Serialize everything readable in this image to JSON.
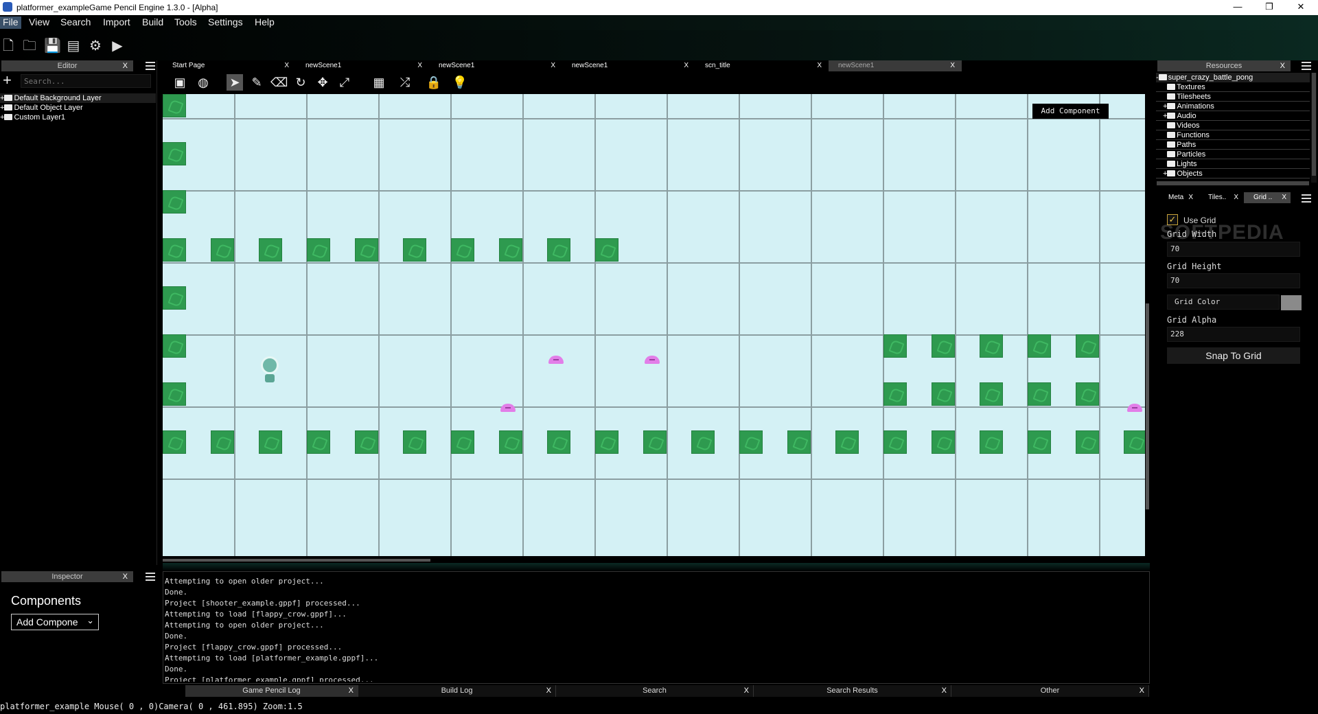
{
  "titlebar": {
    "title": "platformer_exampleGame Pencil Engine  1.3.0 - [Alpha]",
    "minimize": "—",
    "restore": "❐",
    "close": "✕"
  },
  "menu": {
    "items": [
      "File",
      "View",
      "Search",
      "Import",
      "Build",
      "Tools",
      "Settings",
      "Help"
    ],
    "active": "File"
  },
  "toolbar": {
    "icons": [
      "new-file-icon",
      "open-folder-icon",
      "save-icon",
      "save-all-icon",
      "gear-icon",
      "play-icon"
    ]
  },
  "editor_panel": {
    "title": "Editor",
    "close": "X",
    "add": "+",
    "search_placeholder": "Search...",
    "layers": [
      "Default Background Layer",
      "Default Object Layer",
      "Custom Layer1"
    ]
  },
  "inspector_panel": {
    "title": "Inspector",
    "close": "X",
    "components_label": "Components",
    "add_component": "Add Compone"
  },
  "scene_tabs": [
    {
      "label": "Start Page",
      "close": "X",
      "active": false
    },
    {
      "label": "newScene1",
      "close": "X",
      "active": false
    },
    {
      "label": "newScene1",
      "close": "X",
      "active": false
    },
    {
      "label": "newScene1",
      "close": "X",
      "active": false
    },
    {
      "label": "scn_title",
      "close": "X",
      "active": false
    },
    {
      "label": "newScene1",
      "close": "X",
      "active": true
    }
  ],
  "scene_tools": [
    "scene-settings-icon",
    "palette-icon",
    "pointer-icon",
    "pencil-icon",
    "eraser-icon",
    "rotate-icon",
    "move-icon",
    "scale-icon",
    "grid-tiles-icon",
    "shuffle-icon",
    "lock-icon",
    "lightbulb-icon"
  ],
  "canvas": {
    "add_component": "Add Component",
    "background": "#d4f1f5",
    "block_color": "#2e9a4f",
    "enemy_color": "#e27ee8"
  },
  "resources_panel": {
    "title": "Resources",
    "close": "X",
    "root": "super_crazy_battle_pong",
    "items": [
      {
        "label": "Textures",
        "expandable": false
      },
      {
        "label": "Tilesheets",
        "expandable": false
      },
      {
        "label": "Animations",
        "expandable": true
      },
      {
        "label": "Audio",
        "expandable": true
      },
      {
        "label": "Videos",
        "expandable": false
      },
      {
        "label": "Functions",
        "expandable": false
      },
      {
        "label": "Paths",
        "expandable": false
      },
      {
        "label": "Particles",
        "expandable": false
      },
      {
        "label": "Lights",
        "expandable": false
      },
      {
        "label": "Objects",
        "expandable": true
      }
    ]
  },
  "props_tabs": [
    {
      "label": "Meta",
      "close": "X"
    },
    {
      "label": "Tiles..",
      "close": "X"
    },
    {
      "label": "Grid ..",
      "close": "X"
    }
  ],
  "grid_settings": {
    "use_grid_label": "Use Grid",
    "use_grid": true,
    "grid_width_label": "Grid Width",
    "grid_width": "70",
    "grid_height_label": "Grid Height",
    "grid_height": "70",
    "grid_color_label": "Grid Color",
    "grid_color": "#8a8a8a",
    "grid_alpha_label": "Grid Alpha",
    "grid_alpha": "228",
    "snap_button": "Snap To Grid"
  },
  "watermark": "SOFTPEDIA",
  "log": [
    "Attempting to open older project...",
    "Done.",
    "Project [shooter_example.gppf] processed...",
    "Attempting to load [flappy_crow.gppf]...",
    "Attempting to open older project...",
    "Done.",
    "Project [flappy_crow.gppf] processed...",
    "Attempting to load [platformer_example.gppf]...",
    "Done.",
    "Project [platformer_example.gppf] processed..."
  ],
  "bottom_tabs": [
    {
      "label": "Game Pencil Log",
      "close": "X"
    },
    {
      "label": "Build Log",
      "close": "X"
    },
    {
      "label": "Search",
      "close": "X"
    },
    {
      "label": "Search Results",
      "close": "X"
    },
    {
      "label": "Other",
      "close": "X"
    }
  ],
  "statusbar": {
    "text": "platformer_example Mouse( 0 , 0)Camera( 0 , 461.895) Zoom:1.5"
  }
}
